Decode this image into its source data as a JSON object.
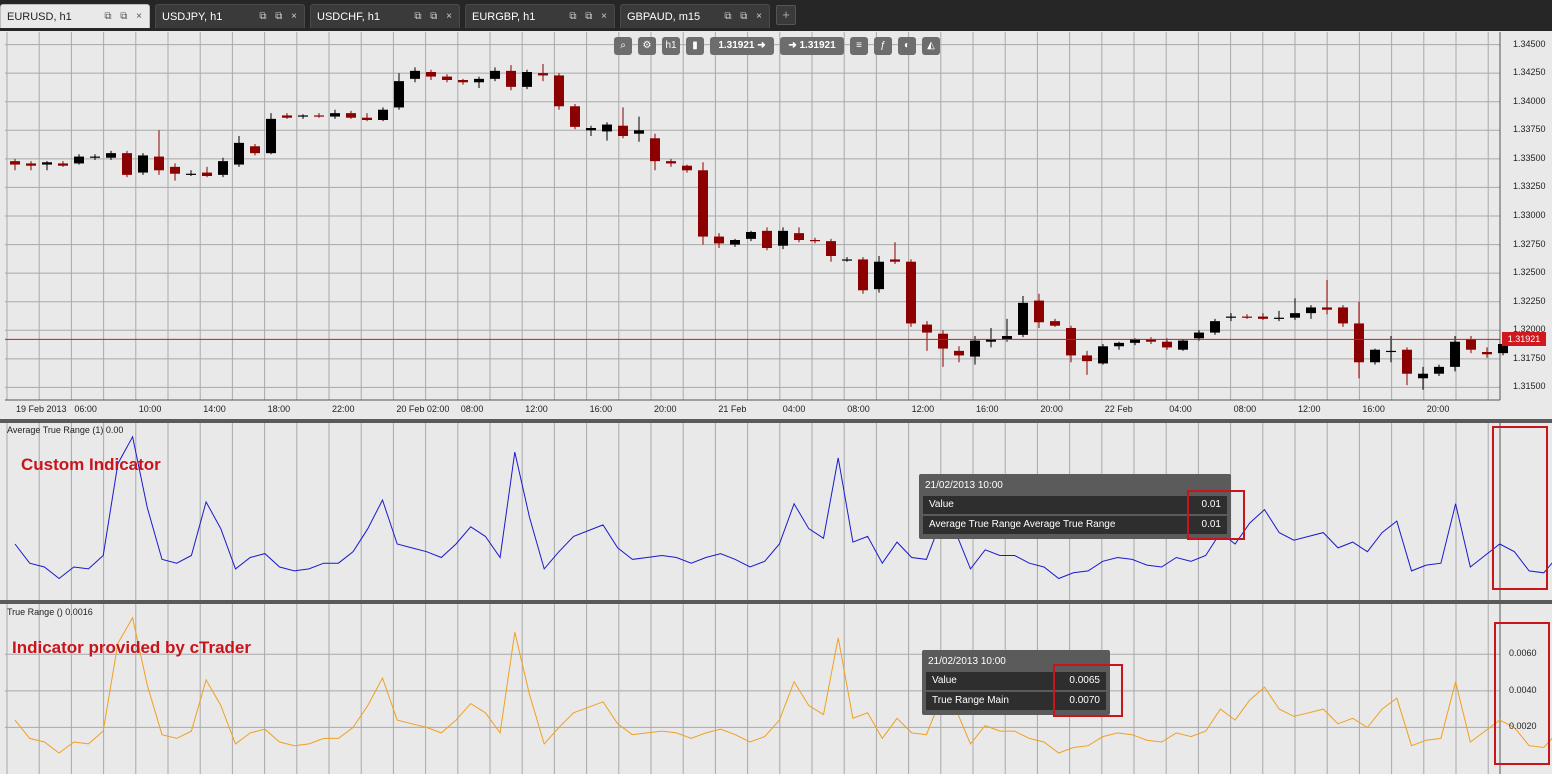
{
  "tabs": [
    {
      "label": "EURUSD, h1",
      "active": true
    },
    {
      "label": "USDJPY, h1",
      "active": false
    },
    {
      "label": "USDCHF, h1",
      "active": false
    },
    {
      "label": "EURGBP, h1",
      "active": false
    },
    {
      "label": "GBPAUD, m15",
      "active": false
    }
  ],
  "tab_icons": "⧉ ⧉ ×",
  "add_tab_label": "+",
  "toolbar": {
    "bid": "1.31921",
    "ask": "1.31921",
    "timeframe": "h1",
    "bid_arrow": "➜",
    "ask_arrow": "➜"
  },
  "current_price": "1.31921",
  "colors": {
    "bull": "#000000",
    "bear": "#8b0000",
    "atr": "#1a1acc",
    "tr": "#f0a020",
    "accent": "#c8141a"
  },
  "price_axis": [
    "1.34500",
    "1.34250",
    "1.34000",
    "1.33750",
    "1.33500",
    "1.33250",
    "1.33000",
    "1.32750",
    "1.32500",
    "1.32250",
    "1.32000",
    "1.31750",
    "1.31500"
  ],
  "time_axis": [
    "19 Feb 2013",
    "06:00",
    "10:00",
    "14:00",
    "18:00",
    "22:00",
    "20 Feb 02:00",
    "08:00",
    "12:00",
    "16:00",
    "20:00",
    "21 Feb",
    "04:00",
    "08:00",
    "12:00",
    "16:00",
    "20:00",
    "22 Feb",
    "04:00",
    "08:00",
    "12:00",
    "16:00",
    "20:00"
  ],
  "atr_panel": {
    "title": "Average True Range (1) 0.00",
    "label": "Custom Indicator",
    "tooltip": {
      "date": "21/02/2013 10:00",
      "rows": [
        {
          "name": "Value",
          "value": "0.01"
        },
        {
          "name": "Average True Range Average True Range",
          "value": "0.01"
        }
      ]
    }
  },
  "tr_panel": {
    "title": "True Range () 0.0016",
    "label": "Indicator provided by cTrader",
    "axis": [
      "0.0060",
      "0.0040",
      "0.0020"
    ],
    "tooltip": {
      "date": "21/02/2013 10:00",
      "rows": [
        {
          "name": "Value",
          "value": "0.0065"
        },
        {
          "name": "True Range Main",
          "value": "0.0070"
        }
      ]
    }
  },
  "chart_data": {
    "type": "candlestick",
    "symbol": "EURUSD",
    "timeframe": "h1",
    "ylim": [
      1.314,
      1.347
    ],
    "candles": [
      [
        1.3348,
        1.335,
        1.334,
        1.3345
      ],
      [
        1.3346,
        1.3348,
        1.334,
        1.3344
      ],
      [
        1.3345,
        1.3348,
        1.334,
        1.3347
      ],
      [
        1.3346,
        1.3348,
        1.3343,
        1.3344
      ],
      [
        1.3346,
        1.3354,
        1.3345,
        1.3352
      ],
      [
        1.3351,
        1.3354,
        1.3349,
        1.3352
      ],
      [
        1.3351,
        1.3357,
        1.3349,
        1.3355
      ],
      [
        1.3355,
        1.3357,
        1.3334,
        1.3336
      ],
      [
        1.3338,
        1.3355,
        1.3336,
        1.3353
      ],
      [
        1.3352,
        1.3375,
        1.3336,
        1.334
      ],
      [
        1.3343,
        1.3346,
        1.3331,
        1.3337
      ],
      [
        1.3336,
        1.334,
        1.3335,
        1.3337
      ],
      [
        1.3338,
        1.3343,
        1.3334,
        1.3335
      ],
      [
        1.3336,
        1.3351,
        1.3334,
        1.3348
      ],
      [
        1.3345,
        1.337,
        1.3343,
        1.3364
      ],
      [
        1.3361,
        1.3363,
        1.3353,
        1.3355
      ],
      [
        1.3355,
        1.339,
        1.3354,
        1.3385
      ],
      [
        1.3388,
        1.339,
        1.3385,
        1.3386
      ],
      [
        1.3387,
        1.3389,
        1.3385,
        1.3388
      ],
      [
        1.3388,
        1.339,
        1.3386,
        1.3387
      ],
      [
        1.3387,
        1.3393,
        1.3385,
        1.339
      ],
      [
        1.339,
        1.3392,
        1.3385,
        1.3386
      ],
      [
        1.3386,
        1.339,
        1.3383,
        1.3384
      ],
      [
        1.3384,
        1.3395,
        1.3383,
        1.3393
      ],
      [
        1.3395,
        1.3425,
        1.3393,
        1.3418
      ],
      [
        1.342,
        1.343,
        1.3417,
        1.3427
      ],
      [
        1.3426,
        1.3428,
        1.3419,
        1.3422
      ],
      [
        1.3422,
        1.3424,
        1.3417,
        1.3419
      ],
      [
        1.3419,
        1.342,
        1.3415,
        1.3417
      ],
      [
        1.3417,
        1.3422,
        1.3412,
        1.342
      ],
      [
        1.342,
        1.343,
        1.3418,
        1.3427
      ],
      [
        1.3427,
        1.3432,
        1.341,
        1.3413
      ],
      [
        1.3413,
        1.3428,
        1.3411,
        1.3426
      ],
      [
        1.3425,
        1.3433,
        1.3418,
        1.3423
      ],
      [
        1.3423,
        1.3425,
        1.3393,
        1.3396
      ],
      [
        1.3396,
        1.3398,
        1.3376,
        1.3378
      ],
      [
        1.3375,
        1.3379,
        1.337,
        1.3377
      ],
      [
        1.3374,
        1.3382,
        1.3366,
        1.338
      ],
      [
        1.3379,
        1.3395,
        1.3368,
        1.337
      ],
      [
        1.3372,
        1.3387,
        1.3365,
        1.3375
      ],
      [
        1.3368,
        1.3372,
        1.334,
        1.3348
      ],
      [
        1.3348,
        1.335,
        1.3343,
        1.3346
      ],
      [
        1.3344,
        1.3345,
        1.3338,
        1.334
      ],
      [
        1.334,
        1.3347,
        1.3275,
        1.3282
      ],
      [
        1.3282,
        1.3285,
        1.3272,
        1.3276
      ],
      [
        1.3275,
        1.328,
        1.3273,
        1.3279
      ],
      [
        1.328,
        1.3287,
        1.3278,
        1.3286
      ],
      [
        1.3287,
        1.329,
        1.327,
        1.3272
      ],
      [
        1.3274,
        1.329,
        1.3271,
        1.3287
      ],
      [
        1.3285,
        1.329,
        1.3277,
        1.3279
      ],
      [
        1.3279,
        1.3281,
        1.3276,
        1.3278
      ],
      [
        1.3278,
        1.328,
        1.326,
        1.3265
      ],
      [
        1.3262,
        1.3264,
        1.326,
        1.3262
      ],
      [
        1.3262,
        1.3264,
        1.3232,
        1.3235
      ],
      [
        1.3236,
        1.3265,
        1.3233,
        1.326
      ],
      [
        1.3262,
        1.3277,
        1.3258,
        1.326
      ],
      [
        1.326,
        1.3262,
        1.3203,
        1.3206
      ],
      [
        1.3205,
        1.3208,
        1.3182,
        1.3198
      ],
      [
        1.3197,
        1.32,
        1.3168,
        1.3184
      ],
      [
        1.3182,
        1.3186,
        1.3172,
        1.3178
      ],
      [
        1.3177,
        1.3195,
        1.317,
        1.3191
      ],
      [
        1.319,
        1.3202,
        1.3185,
        1.3192
      ],
      [
        1.3192,
        1.321,
        1.319,
        1.3195
      ],
      [
        1.3196,
        1.323,
        1.3194,
        1.3224
      ],
      [
        1.3226,
        1.3232,
        1.3202,
        1.3207
      ],
      [
        1.3208,
        1.321,
        1.3203,
        1.3204
      ],
      [
        1.3202,
        1.3204,
        1.3172,
        1.3178
      ],
      [
        1.3178,
        1.3182,
        1.3161,
        1.3173
      ],
      [
        1.3171,
        1.3188,
        1.317,
        1.3186
      ],
      [
        1.3186,
        1.319,
        1.3183,
        1.3189
      ],
      [
        1.3189,
        1.3193,
        1.3187,
        1.3192
      ],
      [
        1.3192,
        1.3194,
        1.3188,
        1.319
      ],
      [
        1.319,
        1.3193,
        1.3183,
        1.3185
      ],
      [
        1.3183,
        1.3192,
        1.3182,
        1.3191
      ],
      [
        1.3193,
        1.32,
        1.3191,
        1.3198
      ],
      [
        1.3198,
        1.321,
        1.3196,
        1.3208
      ],
      [
        1.3211,
        1.3215,
        1.3208,
        1.3212
      ],
      [
        1.3212,
        1.3214,
        1.321,
        1.3211
      ],
      [
        1.3212,
        1.3215,
        1.3209,
        1.321
      ],
      [
        1.321,
        1.3217,
        1.3208,
        1.3211
      ],
      [
        1.3211,
        1.3228,
        1.3209,
        1.3215
      ],
      [
        1.3215,
        1.3222,
        1.321,
        1.322
      ],
      [
        1.322,
        1.3244,
        1.3214,
        1.3218
      ],
      [
        1.322,
        1.3222,
        1.3203,
        1.3206
      ],
      [
        1.3206,
        1.3225,
        1.3158,
        1.3172
      ],
      [
        1.3172,
        1.3184,
        1.317,
        1.3183
      ],
      [
        1.3181,
        1.3195,
        1.3172,
        1.3182
      ],
      [
        1.3183,
        1.3185,
        1.3152,
        1.3162
      ],
      [
        1.3158,
        1.3168,
        1.3148,
        1.3162
      ],
      [
        1.3162,
        1.317,
        1.316,
        1.3168
      ],
      [
        1.3168,
        1.3195,
        1.3164,
        1.319
      ],
      [
        1.3192,
        1.3195,
        1.318,
        1.3183
      ],
      [
        1.3181,
        1.3185,
        1.3176,
        1.3179
      ],
      [
        1.318,
        1.3193,
        1.3178,
        1.3188
      ]
    ],
    "atr_series": [
      0.0024,
      0.0014,
      0.0012,
      0.0006,
      0.0012,
      0.0011,
      0.0018,
      0.0066,
      0.008,
      0.0043,
      0.0016,
      0.0014,
      0.0018,
      0.0046,
      0.0032,
      0.0011,
      0.0017,
      0.0019,
      0.0012,
      0.001,
      0.0011,
      0.0014,
      0.0014,
      0.002,
      0.0032,
      0.0047,
      0.0024,
      0.0022,
      0.002,
      0.0017,
      0.0024,
      0.0033,
      0.0028,
      0.0017,
      0.0072,
      0.0038,
      0.0011,
      0.002,
      0.0028,
      0.0031,
      0.0034,
      0.0022,
      0.0016,
      0.0017,
      0.0018,
      0.0017,
      0.0014,
      0.0017,
      0.0019,
      0.0016,
      0.0012,
      0.0015,
      0.0024,
      0.0045,
      0.0032,
      0.0027,
      0.0069,
      0.0025,
      0.0028,
      0.0014,
      0.0025,
      0.0017,
      0.0016,
      0.0036,
      0.003,
      0.0011,
      0.0021,
      0.0018,
      0.0018,
      0.0014,
      0.0012,
      0.0006,
      0.0009,
      0.001,
      0.0015,
      0.0017,
      0.0016,
      0.0013,
      0.0012,
      0.0017,
      0.0015,
      0.0018,
      0.003,
      0.0024,
      0.0035,
      0.0042,
      0.003,
      0.0026,
      0.0028,
      0.003,
      0.0022,
      0.0025,
      0.002,
      0.003,
      0.0036,
      0.001,
      0.0013,
      0.0014,
      0.0045,
      0.0012,
      0.0018,
      0.0024,
      0.002,
      0.001,
      0.0009,
      0.0018
    ]
  }
}
